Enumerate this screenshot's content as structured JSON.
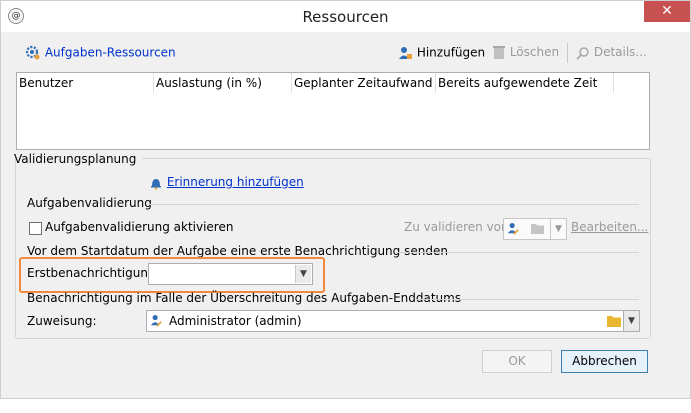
{
  "window": {
    "title": "Ressourcen",
    "close_glyph": "✕"
  },
  "toolbar": {
    "tasks_label": "Aufgaben-Ressourcen",
    "add_label": "Hinzufügen",
    "delete_label": "Löschen",
    "details_label": "Details..."
  },
  "table": {
    "columns": [
      "Benutzer",
      "Auslastung (in %)",
      "Geplanter Zeitaufwand",
      "Bereits aufgewendete Zeit"
    ]
  },
  "validation": {
    "group_label": "Validierungsplanung",
    "add_reminder_link": "Erinnerung hinzufügen",
    "task_validation_label": "Aufgabenvalidierung",
    "activate_checkbox_label": "Aufgabenvalidierung aktivieren",
    "to_validate_label": "Zu validieren von:",
    "edit_link": "Bearbeiten...",
    "first_notification_section": "Vor dem Startdatum der Aufgabe eine erste Benachrichtigung senden",
    "first_notification_label": "Erstbenachrichtigung:",
    "first_notification_value": "",
    "overrun_section": "Benachrichtigung im Falle der Überschreitung des Aufgaben-Enddatums",
    "assignment_label": "Zuweisung:",
    "assignment_value": "Administrator (admin)"
  },
  "buttons": {
    "ok_label": "OK",
    "cancel_label": "Abbrechen"
  },
  "colors": {
    "highlight": "#ef8a3c",
    "link": "#0033cc",
    "close_button": "#c75050"
  },
  "icons": [
    "app-icon",
    "gear-users-icon",
    "add-user-icon",
    "trash-icon",
    "search-icon",
    "bell-icon",
    "user-edit-icon",
    "folder-icon",
    "chevron-down-icon"
  ]
}
